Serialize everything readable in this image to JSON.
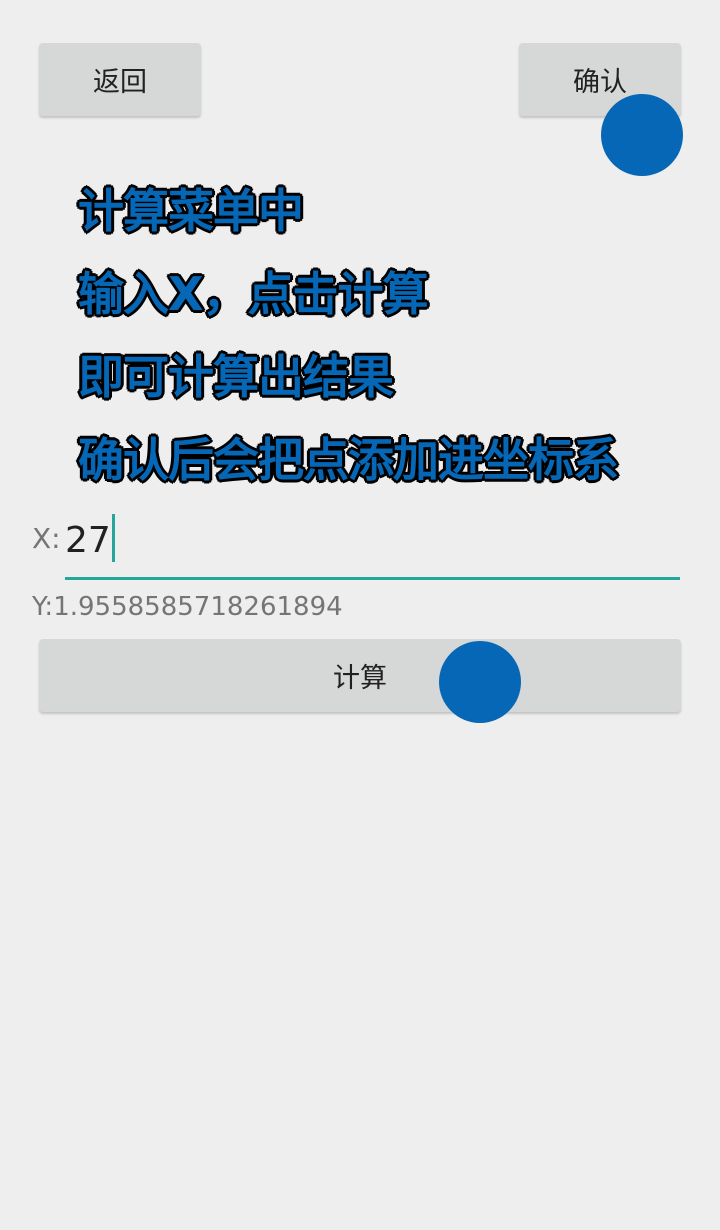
{
  "header": {
    "back_label": "返回",
    "confirm_label": "确认"
  },
  "instructions": [
    "计算菜单中",
    "输入X，点击计算",
    "即可计算出结果",
    "确认后会把点添加进坐标系"
  ],
  "form": {
    "x_label": "X:",
    "x_value": "27",
    "y_result": "Y:1.9558585718261894",
    "calc_label": "计算"
  },
  "colors": {
    "accent": "#26a69a",
    "overlay_text": "#0567b5",
    "touch_indicator": "#0567b5",
    "button_bg": "#d6d7d7",
    "background": "#eeeeee"
  }
}
